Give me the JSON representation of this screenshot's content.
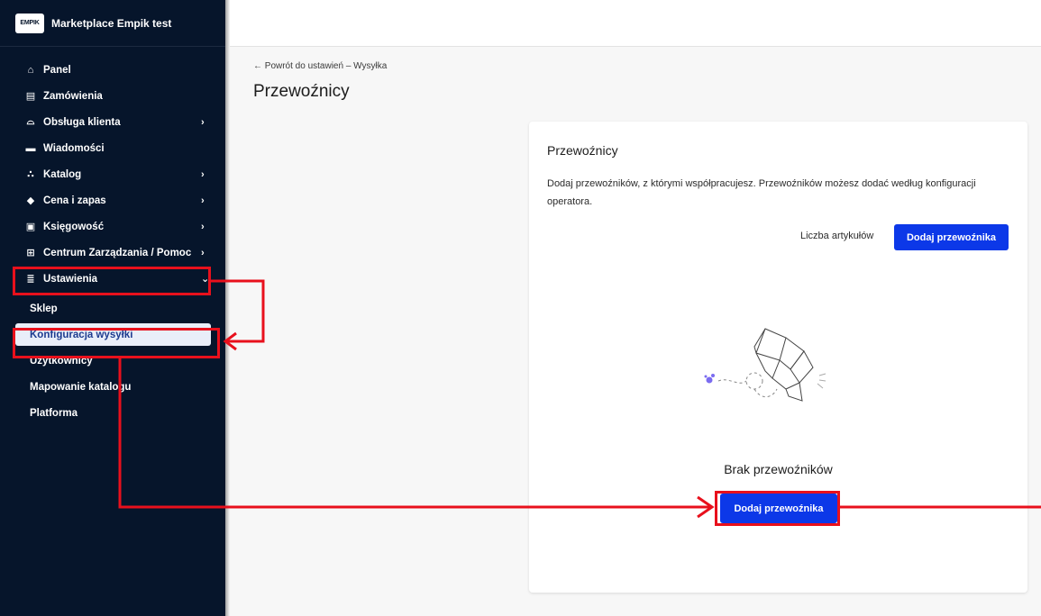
{
  "brand": {
    "logo_text": "EMPIK",
    "title": "Marketplace Empik test"
  },
  "nav": [
    {
      "label": "Panel",
      "icon": "home-icon",
      "glyph": "⌂",
      "chevron": ""
    },
    {
      "label": "Zamówienia",
      "icon": "orders-icon",
      "glyph": "▤",
      "chevron": ""
    },
    {
      "label": "Obsługa klienta",
      "icon": "headset-icon",
      "glyph": "⌓",
      "chevron": "›"
    },
    {
      "label": "Wiadomości",
      "icon": "message-icon",
      "glyph": "▬",
      "chevron": ""
    },
    {
      "label": "Katalog",
      "icon": "catalog-icon",
      "glyph": "∴",
      "chevron": "›"
    },
    {
      "label": "Cena i zapas",
      "icon": "tag-icon",
      "glyph": "◆",
      "chevron": "›"
    },
    {
      "label": "Księgowość",
      "icon": "accounting-icon",
      "glyph": "▣",
      "chevron": "›"
    },
    {
      "label": "Centrum Zarządzania / Pomoc",
      "icon": "grid-icon",
      "glyph": "⊞",
      "chevron": "›"
    },
    {
      "label": "Ustawienia",
      "icon": "sliders-icon",
      "glyph": "≣",
      "chevron": "⌄"
    }
  ],
  "subnav": [
    {
      "label": "Sklep"
    },
    {
      "label": "Konfiguracja wysyłki",
      "active": true
    },
    {
      "label": "Użytkownicy"
    },
    {
      "label": "Mapowanie katalogu"
    },
    {
      "label": "Platforma"
    }
  ],
  "main": {
    "back_link": "← Powrót do ustawień – Wysyłka",
    "page_title": "Przewoźnicy"
  },
  "card": {
    "title": "Przewoźnicy",
    "description": "Dodaj przewoźników, z którymi współpracujesz. Przewoźników możesz dodać według konfiguracji operatora.",
    "items_label": "Liczba artykułów",
    "add_button_top": "Dodaj przewoźnika",
    "empty_text": "Brak przewoźników",
    "add_button_center": "Dodaj przewoźnika"
  },
  "colors": {
    "sidebar": "#06152b",
    "primary": "#0c38e8",
    "annotation": "#e8101c",
    "active_bg": "#e9eef9"
  }
}
